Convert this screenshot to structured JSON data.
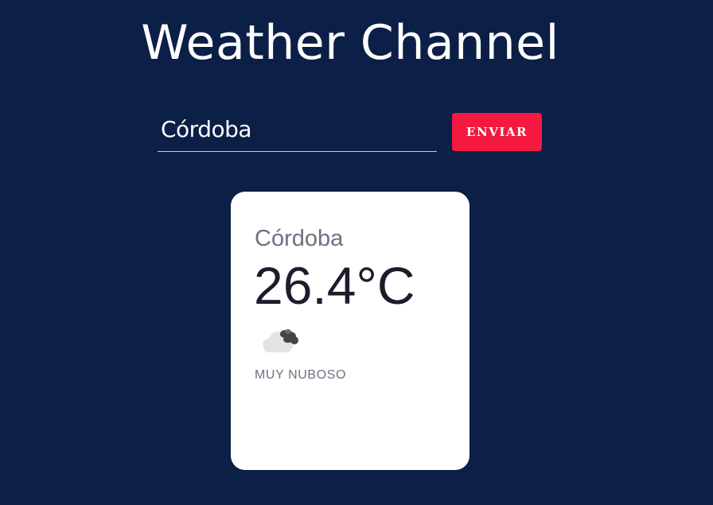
{
  "header": {
    "title": "Weather Channel"
  },
  "search": {
    "value": "Córdoba",
    "button_label": "ENVIAR"
  },
  "weather_card": {
    "city": "Córdoba",
    "temperature": "26.4°C",
    "icon": "mostly-cloudy-icon",
    "description": "MUY NUBOSO"
  },
  "colors": {
    "background": "#0b1f47",
    "button": "#f4193f",
    "card": "#ffffff"
  }
}
